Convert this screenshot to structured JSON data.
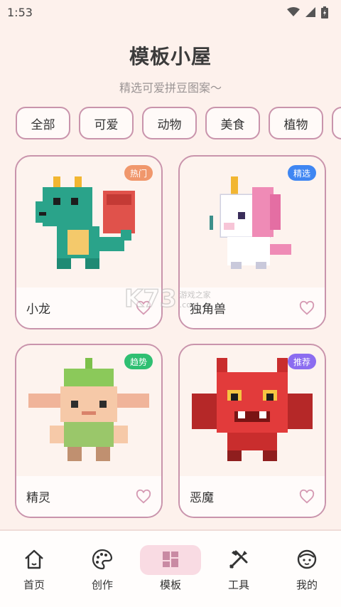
{
  "status": {
    "time": "1:53",
    "icons": [
      "wifi-icon",
      "signal-icon",
      "battery-icon"
    ]
  },
  "header": {
    "title": "模板小屋",
    "subtitle": "精选可爱拼豆图案～"
  },
  "categories": [
    "全部",
    "可爱",
    "动物",
    "美食",
    "植物"
  ],
  "templates": [
    {
      "name": "小龙",
      "badge": "热门",
      "badge_color": "#f0976c",
      "icon": "dragon-image"
    },
    {
      "name": "独角兽",
      "badge": "精选",
      "badge_color": "#3f86f2",
      "icon": "unicorn-image"
    },
    {
      "name": "精灵",
      "badge": "趋势",
      "badge_color": "#2fbf72",
      "icon": "elf-image"
    },
    {
      "name": "恶魔",
      "badge": "推荐",
      "badge_color": "#8b6cf0",
      "icon": "demon-image"
    }
  ],
  "watermark": {
    "logo": "K73",
    "line1": "游戏之家",
    "line2": ".com"
  },
  "nav": [
    {
      "label": "首页",
      "icon": "home-icon",
      "active": false
    },
    {
      "label": "创作",
      "icon": "palette-icon",
      "active": false
    },
    {
      "label": "模板",
      "icon": "grid-icon",
      "active": true
    },
    {
      "label": "工具",
      "icon": "tools-icon",
      "active": false
    },
    {
      "label": "我的",
      "icon": "face-icon",
      "active": false
    }
  ],
  "colors": {
    "accent": "#c994ac",
    "background": "#fdf1ec",
    "active_nav": "#f9dbe3"
  }
}
